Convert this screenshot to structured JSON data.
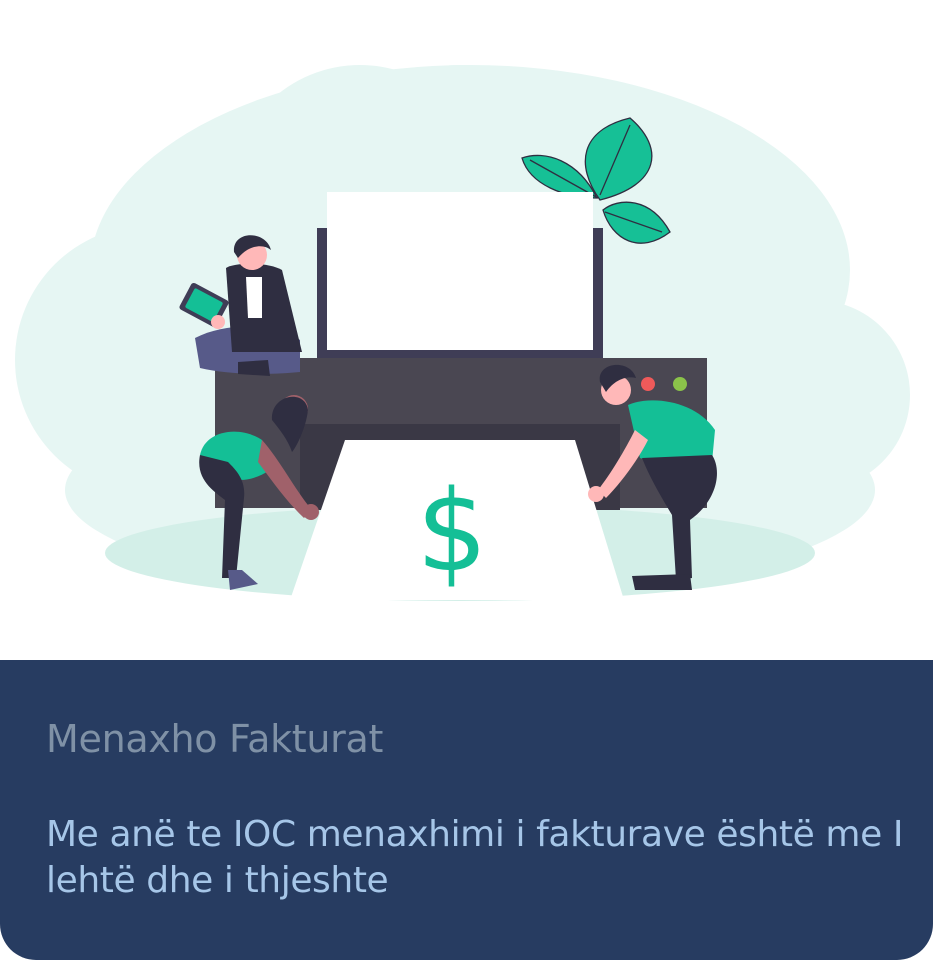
{
  "card": {
    "title": "Menaxho Fakturat",
    "description": "Me anë te IOC menaxhimi i fakturave është me I lehtë dhe i thjeshte"
  },
  "illustration": {
    "subject": "invoice-printer-illustration",
    "currency_symbol": "$",
    "colors": {
      "cloud": "#e6f6f3",
      "accent": "#14bf96",
      "printer": "#4a4752",
      "panel": "#273c61",
      "title": "#7f91a6",
      "description": "#a6c6e8"
    }
  }
}
